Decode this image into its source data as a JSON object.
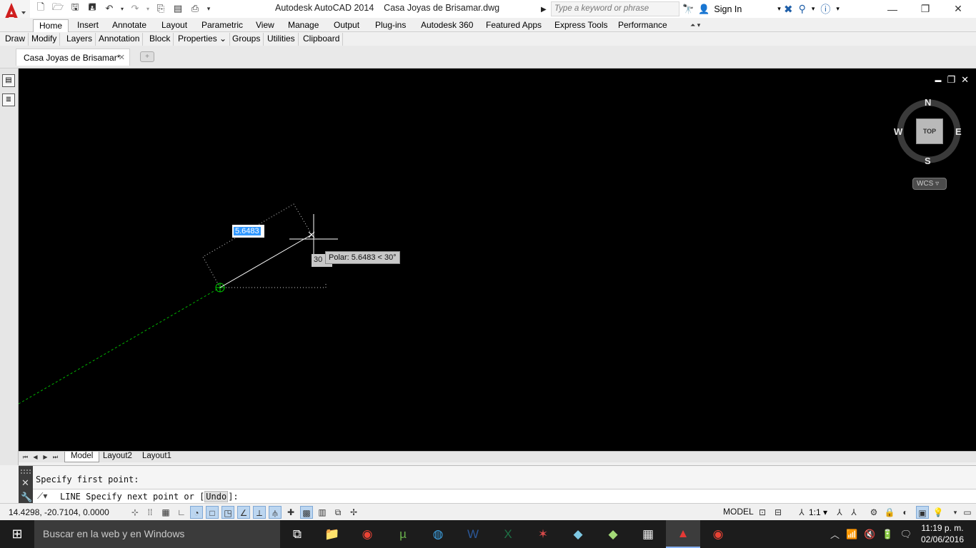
{
  "window": {
    "title": "Autodesk AutoCAD 2014    Casa Joyas de Brisamar.dwg",
    "search_placeholder": "Type a keyword or phrase",
    "sign_in": "Sign In",
    "minimize": "—",
    "restore": "❐",
    "close": "✕"
  },
  "ribbon": {
    "tabs": [
      "Home",
      "Insert",
      "Annotate",
      "Layout",
      "Parametric",
      "View",
      "Manage",
      "Output",
      "Plug-ins",
      "Autodesk 360",
      "Featured Apps",
      "Express Tools",
      "Performance"
    ],
    "active_tab": "Home",
    "panels": [
      "Draw",
      "Modify",
      "Layers",
      "Annotation",
      "Block",
      "Properties ⌄",
      "Groups",
      "Utilities",
      "Clipboard"
    ]
  },
  "file_tab": {
    "name": "Casa Joyas de Brisamar*",
    "close": "✕"
  },
  "viewcube": {
    "n": "N",
    "s": "S",
    "e": "E",
    "w": "W",
    "face": "TOP",
    "wcs": "WCS ▿"
  },
  "viewport_controls": {
    "min": "▬",
    "restore": "❐",
    "close": "✕"
  },
  "dynamic_input": {
    "length": "5.6483",
    "angle": "30",
    "tooltip": "Polar: 5.6483 < 30°"
  },
  "layout_tabs": [
    "Model",
    "Layout2",
    "Layout1"
  ],
  "command": {
    "history": "Specify first point:",
    "prompt_prefix": "LINE Specify next point or [",
    "option": "Undo",
    "prompt_suffix": "]:"
  },
  "status": {
    "coords": "14.4298, -20.7104, 0.0000",
    "model": "MODEL",
    "scale": "1:1 ▾"
  },
  "taskbar": {
    "search": "Buscar en la web y en Windows",
    "time": "11:19 p. m.",
    "date": "02/06/2016"
  },
  "colors": {
    "canvas": "#000000",
    "accent": "#3399ff",
    "rubber_band": "#ffffff",
    "tracking": "#00cc00"
  }
}
